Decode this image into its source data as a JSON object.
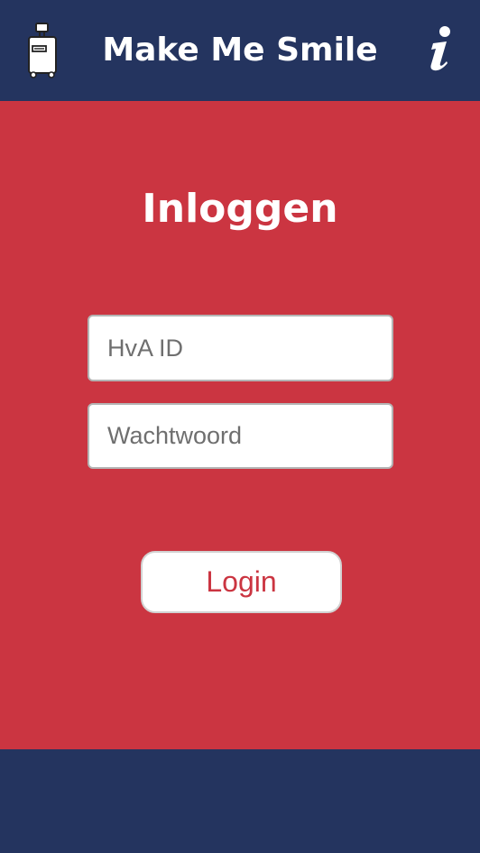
{
  "header": {
    "title": "Make Me Smile",
    "logo_icon": "suitcase-icon",
    "info_icon": "info-icon"
  },
  "login": {
    "title": "Inloggen",
    "id_placeholder": "HvA ID",
    "id_value": "",
    "password_placeholder": "Wachtwoord",
    "password_value": "",
    "button_label": "Login"
  },
  "colors": {
    "header_bg": "#24345f",
    "main_bg": "#cb3541",
    "footer_bg": "#24345f",
    "button_text": "#cb3541",
    "field_border": "#b4b4b4"
  }
}
